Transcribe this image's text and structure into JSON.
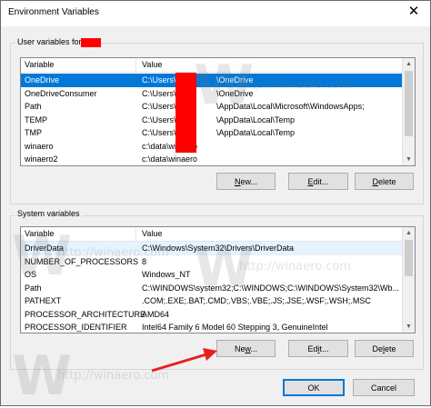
{
  "window": {
    "title": "Environment Variables",
    "close_glyph": "✕"
  },
  "user_vars": {
    "label": "User variables for",
    "columns": [
      "Variable",
      "Value"
    ],
    "rows": [
      {
        "variable": "OneDrive",
        "value_a": "C:\\Users\\",
        "value_b": "\\OneDrive"
      },
      {
        "variable": "OneDriveConsumer",
        "value_a": "C:\\Users\\",
        "value_b": "\\OneDrive"
      },
      {
        "variable": "Path",
        "value_a": "C:\\Users\\",
        "value_b": "\\AppData\\Local\\Microsoft\\WindowsApps;"
      },
      {
        "variable": "TEMP",
        "value_a": "C:\\Users\\",
        "value_b": "\\AppData\\Local\\Temp"
      },
      {
        "variable": "TMP",
        "value_a": "C:\\Users\\",
        "value_b": "\\AppData\\Local\\Temp"
      },
      {
        "variable": "winaero",
        "value_a": "c:\\data\\winaero",
        "value_b": ""
      },
      {
        "variable": "winaero2",
        "value_a": "c:\\data\\winaero",
        "value_b": ""
      }
    ],
    "buttons": {
      "new_pre": "",
      "new_key": "N",
      "new_post": "ew...",
      "edit_pre": "",
      "edit_key": "E",
      "edit_post": "dit...",
      "delete_pre": "",
      "delete_key": "D",
      "delete_post": "elete"
    }
  },
  "system_vars": {
    "label": "System variables",
    "columns": [
      "Variable",
      "Value"
    ],
    "rows": [
      {
        "variable": "DriverData",
        "value": "C:\\Windows\\System32\\Drivers\\DriverData"
      },
      {
        "variable": "NUMBER_OF_PROCESSORS",
        "value": "8"
      },
      {
        "variable": "OS",
        "value": "Windows_NT"
      },
      {
        "variable": "Path",
        "value": "C:\\WINDOWS\\system32;C:\\WINDOWS;C:\\WINDOWS\\System32\\Wb..."
      },
      {
        "variable": "PATHEXT",
        "value": ".COM;.EXE;.BAT;.CMD;.VBS;.VBE;.JS;.JSE;.WSF;.WSH;.MSC"
      },
      {
        "variable": "PROCESSOR_ARCHITECTURE",
        "value": "AMD64"
      },
      {
        "variable": "PROCESSOR_IDENTIFIER",
        "value": "Intel64 Family 6 Model 60 Stepping 3, GenuineIntel"
      }
    ],
    "buttons": {
      "new_pre": "Ne",
      "new_key": "w",
      "new_post": "...",
      "edit_pre": "Ed",
      "edit_key": "i",
      "edit_post": "t...",
      "delete_pre": "De",
      "delete_key": "l",
      "delete_post": "ete"
    }
  },
  "dialog_buttons": {
    "ok": "OK",
    "cancel": "Cancel"
  },
  "watermark": {
    "text": "http://winaero.com",
    "glyph": "W"
  },
  "colors": {
    "selection": "#0078d7",
    "redaction": "#ff0000",
    "arrow": "#e8201a"
  }
}
